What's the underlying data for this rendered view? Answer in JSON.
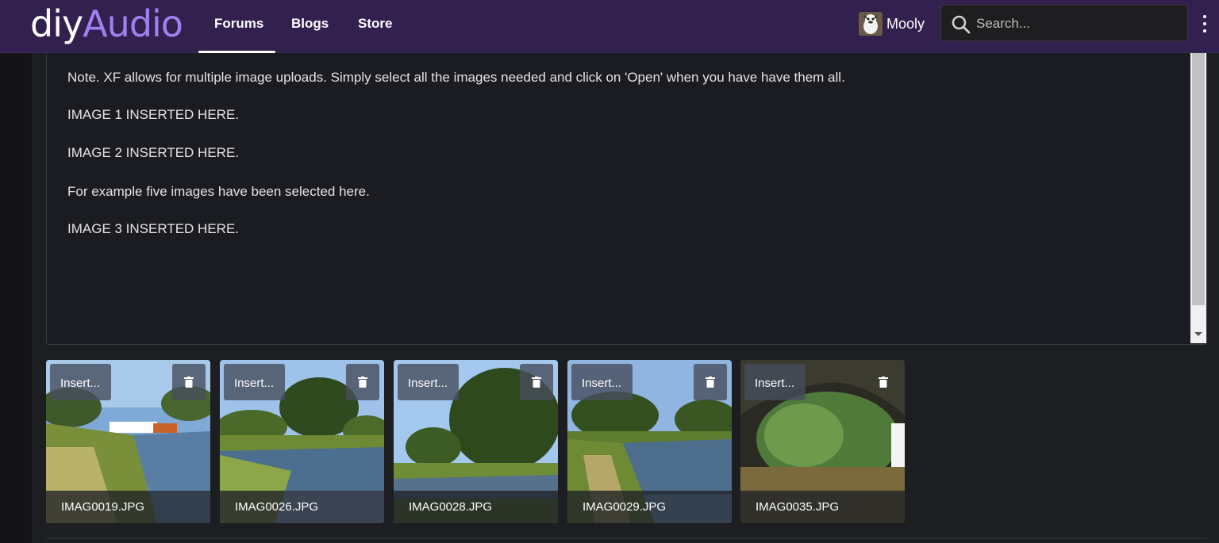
{
  "header": {
    "logo_part1": "diy",
    "logo_part2": "Audio",
    "nav": [
      {
        "label": "Forums",
        "active": true
      },
      {
        "label": "Blogs",
        "active": false
      },
      {
        "label": "Store",
        "active": false
      }
    ],
    "user": {
      "name": "Mooly"
    },
    "search": {
      "placeholder": "Search..."
    },
    "colors": {
      "background": "#32204f",
      "logo_accent": "#a27ff0"
    }
  },
  "editor": {
    "lines": [
      "Note. XF allows for multiple image uploads. Simply select all the images needed and click on 'Open' when you have have them all.",
      "IMAGE 1 INSERTED HERE.",
      "IMAGE 2 INSERTED HERE.",
      "For example five images have been selected here.",
      "IMAGE 3 INSERTED HERE."
    ]
  },
  "attachments": [
    {
      "filename": "IMAG0019.JPG",
      "insert_label": "Insert..."
    },
    {
      "filename": "IMAG0026.JPG",
      "insert_label": "Insert..."
    },
    {
      "filename": "IMAG0028.JPG",
      "insert_label": "Insert..."
    },
    {
      "filename": "IMAG0029.JPG",
      "insert_label": "Insert..."
    },
    {
      "filename": "IMAG0035.JPG",
      "insert_label": "Insert..."
    }
  ]
}
